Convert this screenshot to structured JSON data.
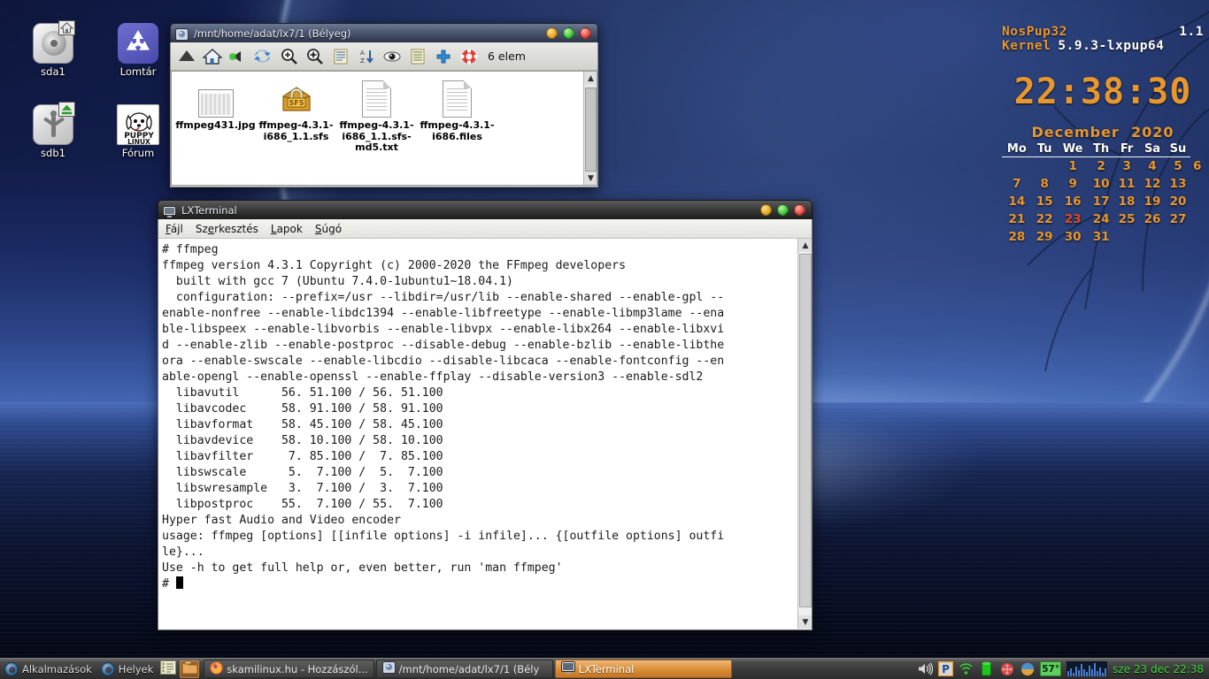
{
  "desktop": {
    "icons": [
      {
        "name": "sda1",
        "icon": "hard-disk-icon",
        "badge": "home"
      },
      {
        "name": "Lomtár",
        "icon": "trash-recycle-icon",
        "badge": ""
      },
      {
        "name": "sdb1",
        "icon": "usb-drive-icon",
        "badge": "eject"
      },
      {
        "name": "Fórum",
        "icon": "puppy-linux-logo-icon",
        "badge": ""
      }
    ]
  },
  "filemanager": {
    "title": "/mnt/home/adat/lx7/1 (Bélyeg)",
    "item_count_label": "6 elem",
    "toolbar": [
      {
        "name": "up-icon",
        "label": "Fel"
      },
      {
        "name": "home-icon",
        "label": "Kezdőkönyvtár"
      },
      {
        "name": "back-icon",
        "label": "Vissza"
      },
      {
        "name": "refresh-icon",
        "label": "Frissítés"
      },
      {
        "name": "zoom-in-icon",
        "label": "Nagyítás"
      },
      {
        "name": "zoom-fit-icon",
        "label": "Illesztés"
      },
      {
        "name": "list-icon",
        "label": "Lista"
      },
      {
        "name": "sort-az-icon",
        "label": "Rendezés"
      },
      {
        "name": "eye-icon",
        "label": "Rejtett fájlok"
      },
      {
        "name": "details-icon",
        "label": "Részletek"
      },
      {
        "name": "plus-icon",
        "label": "Új"
      },
      {
        "name": "help-icon",
        "label": "Súgó"
      }
    ],
    "files": [
      {
        "name": "ffmpeg431.jpg",
        "type": "image"
      },
      {
        "name": "ffmpeg-4.3.1-i686_1.1.sfs",
        "type": "sfs"
      },
      {
        "name": "ffmpeg-4.3.1-i686_1.1.sfs-md5.txt",
        "type": "text"
      },
      {
        "name": "ffmpeg-4.3.1-i686.files",
        "type": "text"
      }
    ],
    "window_buttons": [
      "minimize",
      "maximize",
      "close"
    ]
  },
  "terminal": {
    "title": "LXTerminal",
    "menu": [
      "Fájl",
      "Szerkesztés",
      "Lapok",
      "Súgó"
    ],
    "output": "# ffmpeg\nffmpeg version 4.3.1 Copyright (c) 2000-2020 the FFmpeg developers\n  built with gcc 7 (Ubuntu 7.4.0-1ubuntu1~18.04.1)\n  configuration: --prefix=/usr --libdir=/usr/lib --enable-shared --enable-gpl --\nenable-nonfree --enable-libdc1394 --enable-libfreetype --enable-libmp3lame --ena\nble-libspeex --enable-libvorbis --enable-libvpx --enable-libx264 --enable-libxvi\nd --enable-zlib --enable-postproc --disable-debug --enable-bzlib --enable-libthe\nora --enable-swscale --enable-libcdio --disable-libcaca --enable-fontconfig --en\nable-opengl --enable-openssl --enable-ffplay --disable-version3 --enable-sdl2\n  libavutil      56. 51.100 / 56. 51.100\n  libavcodec     58. 91.100 / 58. 91.100\n  libavformat    58. 45.100 / 58. 45.100\n  libavdevice    58. 10.100 / 58. 10.100\n  libavfilter     7. 85.100 /  7. 85.100\n  libswscale      5.  7.100 /  5.  7.100\n  libswresample   3.  7.100 /  3.  7.100\n  libpostproc    55.  7.100 / 55.  7.100\nHyper fast Audio and Video encoder\nusage: ffmpeg [options] [[infile options] -i infile]... {[outfile options] outfi\nle}...\n",
    "hint_line": "Use -h to get full help or, even better, run 'man ffmpeg'",
    "prompt": "# "
  },
  "conky": {
    "distro_name": "NosPup32",
    "distro_version": "1.1",
    "kernel_label": "Kernel",
    "kernel_version": "5.9.3-lxpup64",
    "clock": "22:38:30",
    "calendar": {
      "month": "December",
      "year": "2020",
      "weekdays": [
        "Mo",
        "Tu",
        "We",
        "Th",
        "Fr",
        "Sa",
        "Su"
      ],
      "weeks": [
        [
          "",
          "",
          "1",
          "2",
          "3",
          "4",
          "5",
          "6"
        ],
        [
          "7",
          "8",
          "9",
          "10",
          "11",
          "12",
          "13"
        ],
        [
          "14",
          "15",
          "16",
          "17",
          "18",
          "19",
          "20"
        ],
        [
          "21",
          "22",
          "23",
          "24",
          "25",
          "26",
          "27"
        ],
        [
          "28",
          "29",
          "30",
          "31",
          "",
          "",
          ""
        ]
      ],
      "today": "23"
    },
    "colors": {
      "accent": "#e8972e",
      "today": "#e34b22",
      "text": "#ffffff"
    }
  },
  "taskbar": {
    "menus": [
      {
        "label": "Alkalmazások",
        "icon": "puppy-menu-icon"
      },
      {
        "label": "Helyek",
        "icon": "places-menu-icon"
      }
    ],
    "launchers": [
      {
        "name": "text-editor-launcher",
        "icon": "notes-icon"
      },
      {
        "name": "file-manager-launcher",
        "icon": "folder-icon",
        "active": true
      }
    ],
    "tasks": [
      {
        "label": "skamilinux.hu - Hozzászól...",
        "icon": "firefox-icon",
        "active": false
      },
      {
        "label": "/mnt/home/adat/lx7/1 (Bély",
        "icon": "file-manager-icon",
        "active": false
      },
      {
        "label": "LXTerminal",
        "icon": "terminal-icon",
        "active": true
      }
    ],
    "tray": [
      {
        "name": "volume-icon",
        "label": "Hangerő"
      },
      {
        "name": "printer-icon",
        "label": "P"
      },
      {
        "name": "wifi-icon",
        "label": "Hálózat"
      },
      {
        "name": "battery-icon",
        "label": "Akkumulátor"
      },
      {
        "name": "puppy-icon",
        "label": "Puppy"
      },
      {
        "name": "palette-icon",
        "label": "Téma"
      }
    ],
    "cpu_temp": "57°",
    "clock": "sze 23 dec 22:38",
    "clock_color": "#3ddc3d",
    "active_color": "#d98c35"
  }
}
